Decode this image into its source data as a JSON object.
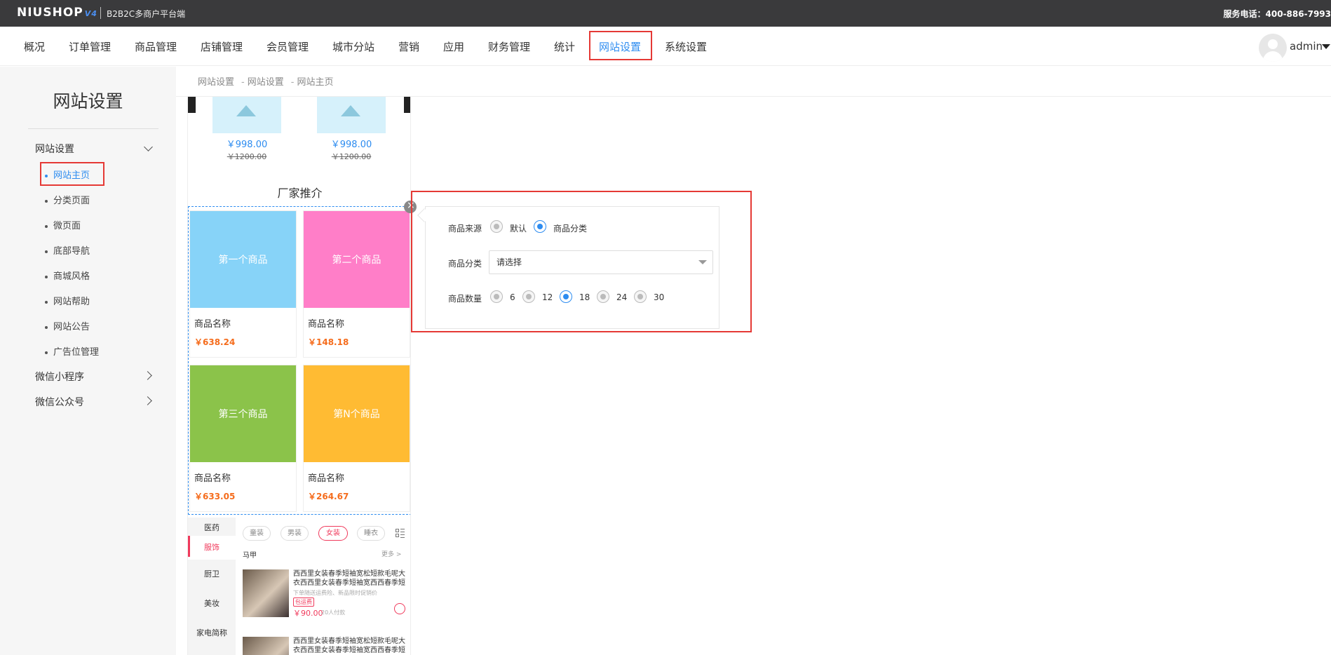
{
  "topbar": {
    "logo": "NIUSHOP",
    "logo_version": "V4",
    "subtitle": "B2B2C多商户平台端",
    "phone": "服务电话：400-886-7993"
  },
  "nav": {
    "items": [
      "概况",
      "订单管理",
      "商品管理",
      "店铺管理",
      "会员管理",
      "城市分站",
      "营销",
      "应用",
      "财务管理",
      "统计",
      "网站设置",
      "系统设置"
    ],
    "active": "网站设置",
    "user": "admin"
  },
  "sidebar": {
    "title": "网站设置",
    "groups": [
      {
        "label": "网站设置",
        "expanded": true,
        "items": [
          "网站主页",
          "分类页面",
          "微页面",
          "底部导航",
          "商城风格",
          "网站帮助",
          "网站公告",
          "广告位管理"
        ]
      },
      {
        "label": "微信小程序",
        "expanded": false
      },
      {
        "label": "微信公众号",
        "expanded": false
      }
    ],
    "active_item": "网站主页"
  },
  "breadcrumb": [
    "网站设置",
    "网站设置",
    "网站主页"
  ],
  "preview": {
    "top_prices": [
      {
        "price": "￥998.00",
        "old": "￥1200.00"
      },
      {
        "price": "￥998.00",
        "old": "￥1200.00"
      }
    ],
    "section_title": "厂家推介",
    "goods": [
      {
        "img_text": "第一个商品",
        "color": "#87d3f8",
        "name": "商品名称",
        "price": "￥638.24"
      },
      {
        "img_text": "第二个商品",
        "color": "#ff7ec8",
        "name": "商品名称",
        "price": "￥148.18"
      },
      {
        "img_text": "第三个商品",
        "color": "#8bc34a",
        "name": "商品名称",
        "price": "￥633.05"
      },
      {
        "img_text": "第N个商品",
        "color": "#ffbb33",
        "name": "商品名称",
        "price": "￥264.67"
      }
    ],
    "categories": [
      "医药",
      "服饰",
      "厨卫",
      "美妆",
      "家电简称"
    ],
    "active_category": "服饰",
    "pills": [
      "童装",
      "男装",
      "女装",
      "睡衣"
    ],
    "active_pill": "女装",
    "sub_head": "马甲",
    "more": "更多 >",
    "products": [
      {
        "title": "西西里女装春季短袖宽松短款毛呢大衣西西里女装春季短袖宽西西春季短袖...",
        "desc": "下单随送运费险、新品限时促销价",
        "tag": "包运费",
        "price": "￥90.00",
        "sales": "20人付款"
      },
      {
        "title": "西西里女装春季短袖宽松短款毛呢大衣西西里女装春季短袖宽西西春季短袖...",
        "desc": "",
        "tag": "",
        "price": "",
        "sales": ""
      }
    ]
  },
  "settings": {
    "source_label": "商品来源",
    "source_options": [
      "默认",
      "商品分类"
    ],
    "source_selected": "商品分类",
    "category_label": "商品分类",
    "category_placeholder": "请选择",
    "count_label": "商品数量",
    "count_options": [
      "6",
      "12",
      "18",
      "24",
      "30"
    ],
    "count_selected": "18"
  }
}
